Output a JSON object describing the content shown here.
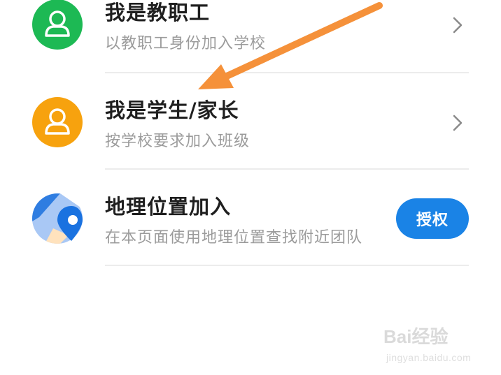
{
  "rows": [
    {
      "title": "我是教职工",
      "subtitle": "以教职工身份加入学校",
      "icon": "person-icon",
      "icon_color": "#1db954"
    },
    {
      "title": "我是学生/家长",
      "subtitle": "按学校要求加入班级",
      "icon": "person-icon",
      "icon_color": "#f7a20e"
    },
    {
      "title": "地理位置加入",
      "subtitle": "在本页面使用地理位置查找附近团队",
      "icon": "map-pin-icon",
      "action_label": "授权",
      "action_color": "#1a83e6"
    }
  ],
  "annotation": {
    "icon": "arrow-icon",
    "color": "#f5913a"
  },
  "watermark": {
    "brand": "Bai经验",
    "url": "jingyan.baidu.com"
  }
}
